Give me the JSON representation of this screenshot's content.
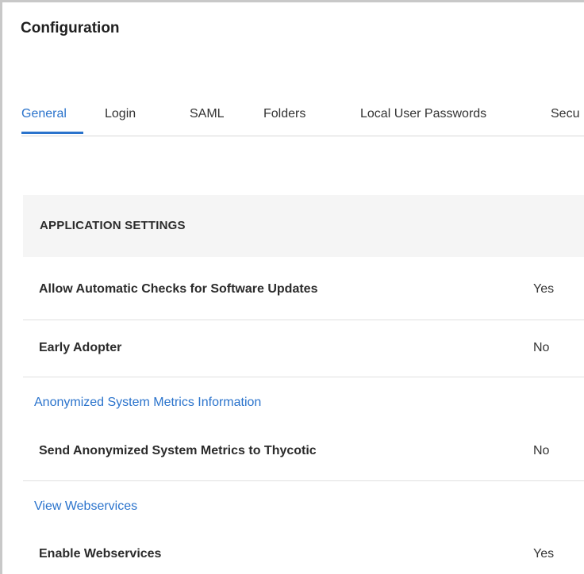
{
  "page": {
    "title": "Configuration"
  },
  "tabs": [
    {
      "label": "General",
      "active": true
    },
    {
      "label": "Login",
      "active": false
    },
    {
      "label": "SAML",
      "active": false
    },
    {
      "label": "Folders",
      "active": false
    },
    {
      "label": "Local User Passwords",
      "active": false
    },
    {
      "label": "Secu",
      "active": false
    }
  ],
  "application_settings": {
    "header": "APPLICATION SETTINGS",
    "rows": [
      {
        "label": "Allow Automatic Checks for Software Updates",
        "value": "Yes"
      },
      {
        "label": "Early Adopter",
        "value": "No"
      }
    ]
  },
  "metrics": {
    "link": "Anonymized System Metrics Information",
    "rows": [
      {
        "label": "Send Anonymized System Metrics to Thycotic",
        "value": "No"
      }
    ]
  },
  "webservices": {
    "link": "View Webservices",
    "rows": [
      {
        "label": "Enable Webservices",
        "value": "Yes"
      }
    ]
  },
  "colors": {
    "accent": "#2a73cc",
    "section_bg": "#f5f5f5",
    "divider": "#e0e0e0"
  }
}
